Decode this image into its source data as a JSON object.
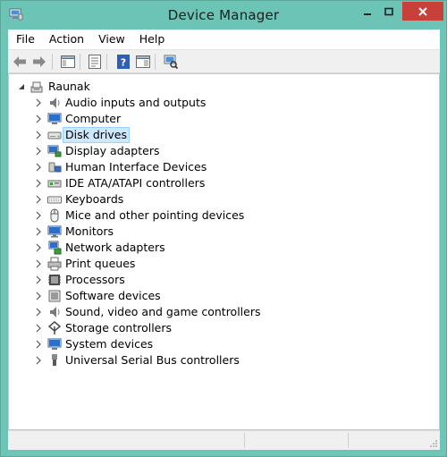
{
  "window": {
    "title": "Device Manager",
    "accent": "#6cc4b7",
    "close_color": "#c7403a"
  },
  "menu": {
    "items": [
      "File",
      "Action",
      "View",
      "Help"
    ]
  },
  "toolbar": {
    "buttons": [
      {
        "name": "back-arrow-icon"
      },
      {
        "name": "forward-arrow-icon"
      },
      {
        "name": "show-hide-console-tree-icon"
      },
      {
        "name": "properties-icon"
      },
      {
        "name": "help-icon"
      },
      {
        "name": "action-pane-icon"
      },
      {
        "name": "scan-hardware-icon"
      }
    ]
  },
  "tree": {
    "root": {
      "label": "Raunak",
      "icon": "computer-root-icon",
      "expanded": true
    },
    "selected_color": "#cce8ff",
    "items": [
      {
        "label": "Audio inputs and outputs",
        "icon": "speaker-icon"
      },
      {
        "label": "Computer",
        "icon": "computer-icon"
      },
      {
        "label": "Disk drives",
        "icon": "disk-drive-icon",
        "selected": true
      },
      {
        "label": "Display adapters",
        "icon": "display-adapter-icon"
      },
      {
        "label": "Human Interface Devices",
        "icon": "hid-icon"
      },
      {
        "label": "IDE ATA/ATAPI controllers",
        "icon": "ide-controller-icon"
      },
      {
        "label": "Keyboards",
        "icon": "keyboard-icon"
      },
      {
        "label": "Mice and other pointing devices",
        "icon": "mouse-icon"
      },
      {
        "label": "Monitors",
        "icon": "monitor-icon"
      },
      {
        "label": "Network adapters",
        "icon": "network-adapter-icon"
      },
      {
        "label": "Print queues",
        "icon": "printer-icon"
      },
      {
        "label": "Processors",
        "icon": "processor-icon"
      },
      {
        "label": "Software devices",
        "icon": "software-device-icon"
      },
      {
        "label": "Sound, video and game controllers",
        "icon": "sound-controller-icon"
      },
      {
        "label": "Storage controllers",
        "icon": "storage-controller-icon"
      },
      {
        "label": "System devices",
        "icon": "system-device-icon"
      },
      {
        "label": "Universal Serial Bus controllers",
        "icon": "usb-icon"
      }
    ]
  }
}
